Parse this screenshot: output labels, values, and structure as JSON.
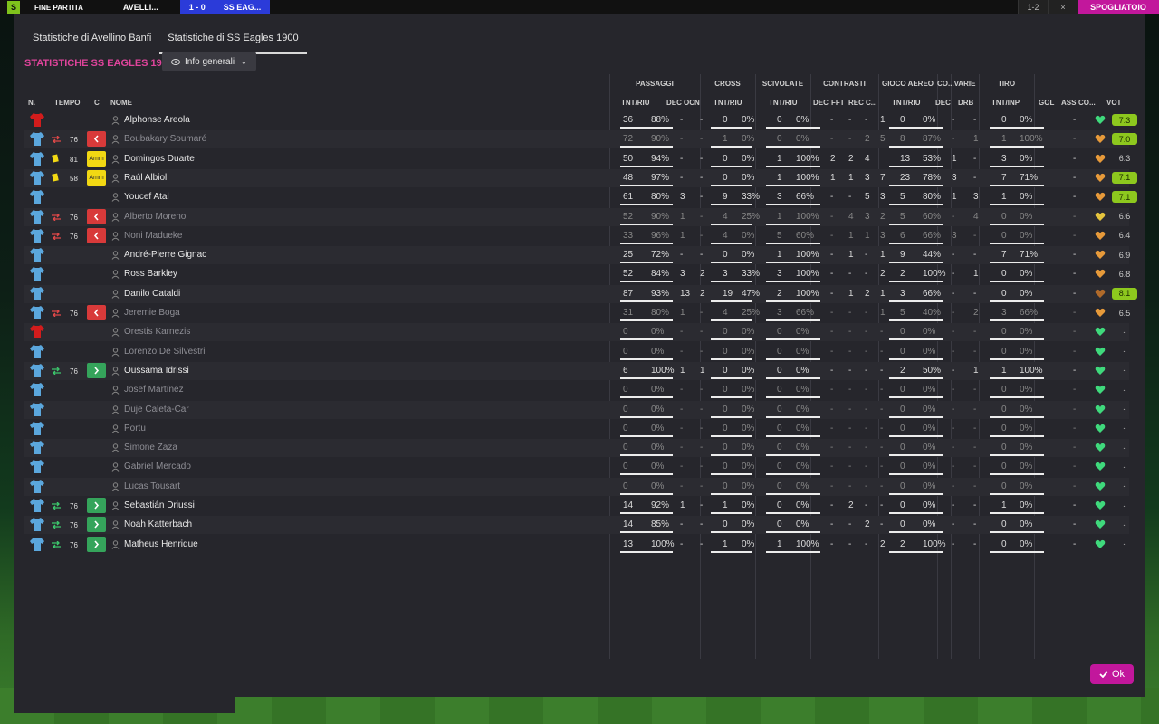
{
  "topbar": {
    "logo": "S",
    "fine_partita": "FINE PARTITA",
    "team_home": "AVELLI...",
    "score": "1 - 0",
    "team_away": "SS EAG...",
    "small1": "1-2",
    "small2": "×",
    "pink": "SPOGLIATOIO"
  },
  "tabs": [
    {
      "label": "Statistiche di Avellino Banfi",
      "active": false
    },
    {
      "label": "Statistiche di SS Eagles 1900",
      "active": true
    }
  ],
  "section_title": "STATISTICHE SS EAGLES 1900",
  "view_dropdown": {
    "label": "Info generali"
  },
  "ok_label": "Ok",
  "headers": {
    "n": "N.",
    "tempo": "TEMPO",
    "c": "C",
    "nome": "NOME",
    "groups": {
      "passaggi": "PASSAGGI",
      "cross": "CROSS",
      "scivolate": "SCIVOLATE",
      "contrasti": "CONTRASTI",
      "gioco_aereo": "GIOCO AEREO",
      "co": "CO...",
      "varie": "VARIE",
      "tiro": "TIRO"
    },
    "cols": {
      "pass_tnt": "TNT/RIU",
      "pass_dec": "DEC",
      "pass_ocn": "OCN",
      "cross_tnt": "TNT/RIU",
      "sciv_tnt": "TNT/RIU",
      "con_dec": "DEC",
      "con_fft": "FFT",
      "con_rec": "REC",
      "con_c": "C...",
      "aer_tnt": "TNT/RIU",
      "co_dec": "DEC",
      "drb": "DRB",
      "tiro_tnt": "TNT/INP",
      "gol": "GOL",
      "ass": "ASS",
      "co2": "CO...",
      "vot": "VOT"
    }
  },
  "colors": {
    "accent": "#c2179c",
    "title_pink": "#e0449c",
    "vote_green": "#8dc81e",
    "out_red": "#d83a3a",
    "in_green": "#35a45b",
    "yellow_card": "#f2d813",
    "shirt_blue": "#5ba7dd",
    "gk_red": "#d21c1c"
  },
  "players": [
    {
      "name": "Alphonse Areola",
      "gk": true,
      "played": true,
      "pass": [
        "36",
        "88%"
      ],
      "pass_dec": "-",
      "pass_ocn": "-",
      "cross": [
        "0",
        "0%"
      ],
      "sciv": [
        "0",
        "0%"
      ],
      "con": [
        "-",
        "-",
        "-",
        "1"
      ],
      "aer": [
        "0",
        "0%"
      ],
      "co_dec": "-",
      "drb": "-",
      "tiro": [
        "0",
        "0%"
      ],
      "gol": "",
      "ass": "-",
      "heart": "green",
      "vot": "7.3",
      "vot_green": true
    },
    {
      "name": "Boubakary Soumaré",
      "sub": "out",
      "min": "76",
      "played": false,
      "pass": [
        "72",
        "90%"
      ],
      "pass_dec": "-",
      "pass_ocn": "-",
      "cross": [
        "1",
        "0%"
      ],
      "sciv": [
        "0",
        "0%"
      ],
      "con": [
        "-",
        "-",
        "2",
        "5"
      ],
      "aer": [
        "8",
        "87%"
      ],
      "co_dec": "-",
      "drb": "1",
      "tiro": [
        "1",
        "100%"
      ],
      "gol": "",
      "ass": "-",
      "heart": "orange",
      "vot": "7.0",
      "vot_green": true
    },
    {
      "name": "Domingos Duarte",
      "card": "yellow",
      "min": "81",
      "cbox": "amm",
      "played": true,
      "pass": [
        "50",
        "94%"
      ],
      "pass_dec": "-",
      "pass_ocn": "-",
      "cross": [
        "0",
        "0%"
      ],
      "sciv": [
        "1",
        "100%"
      ],
      "con": [
        "2",
        "2",
        "4"
      ],
      "con_extra": "-",
      "aer": [
        "13",
        "53%"
      ],
      "co_dec": "1",
      "drb": "-",
      "tiro": [
        "3",
        "0%"
      ],
      "gol": "",
      "ass": "-",
      "heart": "orange",
      "vot": "6.3",
      "vot_green": false
    },
    {
      "name": "Raúl Albiol",
      "card": "yellow",
      "min": "58",
      "cbox": "amm",
      "played": true,
      "pass": [
        "48",
        "97%"
      ],
      "pass_dec": "-",
      "pass_ocn": "-",
      "cross": [
        "0",
        "0%"
      ],
      "sciv": [
        "1",
        "100%"
      ],
      "con": [
        "1",
        "1",
        "3",
        "7"
      ],
      "aer": [
        "23",
        "78%"
      ],
      "co_dec": "3",
      "drb": "-",
      "tiro": [
        "7",
        "71%"
      ],
      "gol": "",
      "ass": "-",
      "heart": "orange",
      "vot": "7.1",
      "vot_green": true
    },
    {
      "name": "Youcef Atal",
      "played": true,
      "pass": [
        "61",
        "80%"
      ],
      "pass_dec": "3",
      "pass_ocn": "-",
      "cross": [
        "9",
        "33%"
      ],
      "sciv": [
        "3",
        "66%"
      ],
      "con": [
        "-",
        "-",
        "5",
        "3"
      ],
      "aer": [
        "5",
        "80%"
      ],
      "co_dec": "1",
      "drb": "3",
      "tiro": [
        "1",
        "0%"
      ],
      "gol": "",
      "ass": "-",
      "heart": "orange",
      "vot": "7.1",
      "vot_green": true
    },
    {
      "name": "Alberto Moreno",
      "sub": "out",
      "min": "76",
      "played": false,
      "pass": [
        "52",
        "90%"
      ],
      "pass_dec": "1",
      "pass_ocn": "-",
      "cross": [
        "4",
        "25%"
      ],
      "sciv": [
        "1",
        "100%"
      ],
      "con": [
        "-",
        "4",
        "3",
        "2"
      ],
      "aer": [
        "5",
        "60%"
      ],
      "co_dec": "-",
      "drb": "4",
      "tiro": [
        "0",
        "0%"
      ],
      "gol": "",
      "ass": "-",
      "heart": "yellow",
      "vot": "6.6",
      "vot_green": false
    },
    {
      "name": "Noni Madueke",
      "sub": "out",
      "min": "76",
      "played": false,
      "pass": [
        "33",
        "96%"
      ],
      "pass_dec": "1",
      "pass_ocn": "-",
      "cross": [
        "4",
        "0%"
      ],
      "sciv": [
        "5",
        "60%"
      ],
      "con": [
        "-",
        "1",
        "1",
        "3"
      ],
      "aer": [
        "6",
        "66%"
      ],
      "co_dec": "3",
      "drb": "-",
      "tiro": [
        "0",
        "0%"
      ],
      "gol": "",
      "ass": "-",
      "heart": "orange",
      "vot": "6.4",
      "vot_green": false
    },
    {
      "name": "André-Pierre Gignac",
      "played": true,
      "pass": [
        "25",
        "72%"
      ],
      "pass_dec": "-",
      "pass_ocn": "-",
      "cross": [
        "0",
        "0%"
      ],
      "sciv": [
        "1",
        "100%"
      ],
      "con": [
        "-",
        "1",
        "-",
        "1"
      ],
      "aer": [
        "9",
        "44%"
      ],
      "co_dec": "-",
      "drb": "-",
      "tiro": [
        "7",
        "71%"
      ],
      "gol": "",
      "ass": "-",
      "heart": "orange",
      "vot": "6.9",
      "vot_green": false
    },
    {
      "name": "Ross Barkley",
      "played": true,
      "pass": [
        "52",
        "84%"
      ],
      "pass_dec": "3",
      "pass_ocn": "2",
      "cross": [
        "3",
        "33%"
      ],
      "sciv": [
        "3",
        "100%"
      ],
      "con": [
        "-",
        "-",
        "-",
        "2"
      ],
      "aer": [
        "2",
        "100%"
      ],
      "co_dec": "-",
      "drb": "1",
      "tiro": [
        "0",
        "0%"
      ],
      "gol": "",
      "ass": "-",
      "heart": "orange",
      "vot": "6.8",
      "vot_green": false
    },
    {
      "name": "Danilo Cataldi",
      "played": true,
      "pass": [
        "87",
        "93%"
      ],
      "pass_dec": "13",
      "pass_ocn": "2",
      "cross": [
        "19",
        "47%"
      ],
      "sciv": [
        "2",
        "100%"
      ],
      "con": [
        "-",
        "1",
        "2",
        "1"
      ],
      "aer": [
        "3",
        "66%"
      ],
      "co_dec": "-",
      "drb": "-",
      "tiro": [
        "0",
        "0%"
      ],
      "gol": "",
      "ass": "-",
      "heart": "brown",
      "vot": "8.1",
      "vot_green": true
    },
    {
      "name": "Jeremie Boga",
      "sub": "out",
      "min": "76",
      "played": false,
      "pass": [
        "31",
        "80%"
      ],
      "pass_dec": "1",
      "pass_ocn": "-",
      "cross": [
        "4",
        "25%"
      ],
      "sciv": [
        "3",
        "66%"
      ],
      "con": [
        "-",
        "-",
        "-",
        "1"
      ],
      "aer": [
        "5",
        "40%"
      ],
      "co_dec": "-",
      "drb": "2",
      "tiro": [
        "3",
        "66%"
      ],
      "gol": "",
      "ass": "-",
      "heart": "orange",
      "vot": "6.5",
      "vot_green": false
    },
    {
      "name": "Orestis Karnezis",
      "gk": true,
      "played": false,
      "pass": [
        "0",
        "0%"
      ],
      "pass_dec": "-",
      "pass_ocn": "-",
      "cross": [
        "0",
        "0%"
      ],
      "sciv": [
        "0",
        "0%"
      ],
      "con": [
        "-",
        "-",
        "-",
        "-"
      ],
      "aer": [
        "0",
        "0%"
      ],
      "co_dec": "-",
      "drb": "-",
      "tiro": [
        "0",
        "0%"
      ],
      "gol": "",
      "ass": "-",
      "heart": "green",
      "vot": "-",
      "vot_green": false
    },
    {
      "name": "Lorenzo De Silvestri",
      "played": false,
      "pass": [
        "0",
        "0%"
      ],
      "pass_dec": "-",
      "pass_ocn": "-",
      "cross": [
        "0",
        "0%"
      ],
      "sciv": [
        "0",
        "0%"
      ],
      "con": [
        "-",
        "-",
        "-",
        "-"
      ],
      "aer": [
        "0",
        "0%"
      ],
      "co_dec": "-",
      "drb": "-",
      "tiro": [
        "0",
        "0%"
      ],
      "gol": "",
      "ass": "-",
      "heart": "green",
      "vot": "-",
      "vot_green": false
    },
    {
      "name": "Oussama Idrissi",
      "sub": "in",
      "min": "76",
      "played": true,
      "pass": [
        "6",
        "100%"
      ],
      "pass_dec": "1",
      "pass_ocn": "1",
      "cross": [
        "0",
        "0%"
      ],
      "sciv": [
        "0",
        "0%"
      ],
      "con": [
        "-",
        "-",
        "-",
        "-"
      ],
      "aer": [
        "2",
        "50%"
      ],
      "co_dec": "-",
      "drb": "1",
      "tiro": [
        "1",
        "100%"
      ],
      "gol": "",
      "ass": "-",
      "heart": "green",
      "vot": "-",
      "vot_green": false
    },
    {
      "name": "Josef Martínez",
      "played": false,
      "pass": [
        "0",
        "0%"
      ],
      "pass_dec": "-",
      "pass_ocn": "-",
      "cross": [
        "0",
        "0%"
      ],
      "sciv": [
        "0",
        "0%"
      ],
      "con": [
        "-",
        "-",
        "-",
        "-"
      ],
      "aer": [
        "0",
        "0%"
      ],
      "co_dec": "-",
      "drb": "-",
      "tiro": [
        "0",
        "0%"
      ],
      "gol": "",
      "ass": "-",
      "heart": "green",
      "vot": "-",
      "vot_green": false
    },
    {
      "name": "Duje Caleta-Car",
      "played": false,
      "pass": [
        "0",
        "0%"
      ],
      "pass_dec": "-",
      "pass_ocn": "-",
      "cross": [
        "0",
        "0%"
      ],
      "sciv": [
        "0",
        "0%"
      ],
      "con": [
        "-",
        "-",
        "-",
        "-"
      ],
      "aer": [
        "0",
        "0%"
      ],
      "co_dec": "-",
      "drb": "-",
      "tiro": [
        "0",
        "0%"
      ],
      "gol": "",
      "ass": "-",
      "heart": "green",
      "vot": "-",
      "vot_green": false
    },
    {
      "name": "Portu",
      "played": false,
      "pass": [
        "0",
        "0%"
      ],
      "pass_dec": "-",
      "pass_ocn": "-",
      "cross": [
        "0",
        "0%"
      ],
      "sciv": [
        "0",
        "0%"
      ],
      "con": [
        "-",
        "-",
        "-",
        "-"
      ],
      "aer": [
        "0",
        "0%"
      ],
      "co_dec": "-",
      "drb": "-",
      "tiro": [
        "0",
        "0%"
      ],
      "gol": "",
      "ass": "-",
      "heart": "green",
      "vot": "-",
      "vot_green": false
    },
    {
      "name": "Simone Zaza",
      "played": false,
      "pass": [
        "0",
        "0%"
      ],
      "pass_dec": "-",
      "pass_ocn": "-",
      "cross": [
        "0",
        "0%"
      ],
      "sciv": [
        "0",
        "0%"
      ],
      "con": [
        "-",
        "-",
        "-",
        "-"
      ],
      "aer": [
        "0",
        "0%"
      ],
      "co_dec": "-",
      "drb": "-",
      "tiro": [
        "0",
        "0%"
      ],
      "gol": "",
      "ass": "-",
      "heart": "green",
      "vot": "-",
      "vot_green": false
    },
    {
      "name": "Gabriel Mercado",
      "played": false,
      "pass": [
        "0",
        "0%"
      ],
      "pass_dec": "-",
      "pass_ocn": "-",
      "cross": [
        "0",
        "0%"
      ],
      "sciv": [
        "0",
        "0%"
      ],
      "con": [
        "-",
        "-",
        "-",
        "-"
      ],
      "aer": [
        "0",
        "0%"
      ],
      "co_dec": "-",
      "drb": "-",
      "tiro": [
        "0",
        "0%"
      ],
      "gol": "",
      "ass": "-",
      "heart": "green",
      "vot": "-",
      "vot_green": false
    },
    {
      "name": "Lucas Tousart",
      "played": false,
      "pass": [
        "0",
        "0%"
      ],
      "pass_dec": "-",
      "pass_ocn": "-",
      "cross": [
        "0",
        "0%"
      ],
      "sciv": [
        "0",
        "0%"
      ],
      "con": [
        "-",
        "-",
        "-",
        "-"
      ],
      "aer": [
        "0",
        "0%"
      ],
      "co_dec": "-",
      "drb": "-",
      "tiro": [
        "0",
        "0%"
      ],
      "gol": "",
      "ass": "-",
      "heart": "green",
      "vot": "-",
      "vot_green": false
    },
    {
      "name": "Sebastián Driussi",
      "sub": "in",
      "min": "76",
      "played": true,
      "pass": [
        "14",
        "92%"
      ],
      "pass_dec": "1",
      "pass_ocn": "-",
      "cross": [
        "1",
        "0%"
      ],
      "sciv": [
        "0",
        "0%"
      ],
      "con": [
        "-",
        "2",
        "-",
        "-"
      ],
      "aer": [
        "0",
        "0%"
      ],
      "co_dec": "-",
      "drb": "-",
      "tiro": [
        "1",
        "0%"
      ],
      "gol": "",
      "ass": "-",
      "heart": "green",
      "vot": "-",
      "vot_green": false
    },
    {
      "name": "Noah Katterbach",
      "sub": "in",
      "min": "76",
      "played": true,
      "pass": [
        "14",
        "85%"
      ],
      "pass_dec": "-",
      "pass_ocn": "-",
      "cross": [
        "0",
        "0%"
      ],
      "sciv": [
        "0",
        "0%"
      ],
      "con": [
        "-",
        "-",
        "2",
        "-"
      ],
      "aer": [
        "0",
        "0%"
      ],
      "co_dec": "-",
      "drb": "-",
      "tiro": [
        "0",
        "0%"
      ],
      "gol": "",
      "ass": "-",
      "heart": "green",
      "vot": "-",
      "vot_green": false
    },
    {
      "name": "Matheus Henrique",
      "sub": "in",
      "min": "76",
      "played": true,
      "pass": [
        "13",
        "100%"
      ],
      "pass_dec": "-",
      "pass_ocn": "-",
      "cross": [
        "1",
        "0%"
      ],
      "sciv": [
        "1",
        "100%"
      ],
      "con": [
        "-",
        "-",
        "-",
        "2"
      ],
      "aer": [
        "2",
        "100%"
      ],
      "co_dec": "-",
      "drb": "-",
      "tiro": [
        "0",
        "0%"
      ],
      "gol": "",
      "ass": "-",
      "heart": "green",
      "vot": "-",
      "vot_green": false
    }
  ]
}
